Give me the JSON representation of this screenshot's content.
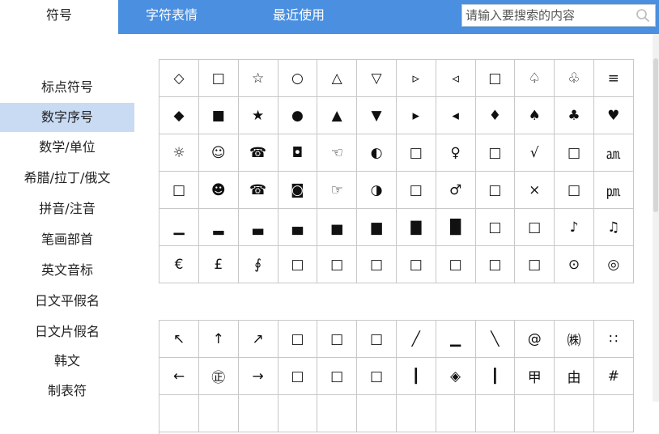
{
  "tabs": [
    {
      "label": "符号"
    },
    {
      "label": "字符表情"
    },
    {
      "label": "最近使用"
    }
  ],
  "search": {
    "placeholder": "请输入要搜索的内容"
  },
  "sidebar": {
    "items": [
      {
        "label": "标点符号"
      },
      {
        "label": "数字序号"
      },
      {
        "label": "数学/单位"
      },
      {
        "label": "希腊/拉丁/俄文"
      },
      {
        "label": "拼音/注音"
      },
      {
        "label": "笔画部首"
      },
      {
        "label": "英文音标"
      },
      {
        "label": "日文平假名"
      },
      {
        "label": "日文片假名"
      },
      {
        "label": "韩文"
      },
      {
        "label": "制表符"
      }
    ],
    "active_index": 1
  },
  "grids": [
    {
      "rows": [
        [
          "◇",
          "□",
          "☆",
          "○",
          "△",
          "▽",
          "▹",
          "◃",
          "□",
          "♤",
          "♧",
          "≡"
        ],
        [
          "◆",
          "■",
          "★",
          "●",
          "▲",
          "▼",
          "▸",
          "◂",
          "♦",
          "♠",
          "♣",
          "♥"
        ],
        [
          "☼",
          "☺",
          "☎",
          "◘",
          "☜",
          "◐",
          "□",
          "♀",
          "□",
          "√",
          "□",
          "㏂"
        ],
        [
          "□",
          "☻",
          "☎",
          "◙",
          "☞",
          "◑",
          "□",
          "♂",
          "□",
          "×",
          "□",
          "㏘"
        ],
        [
          "▁",
          "▂",
          "▃",
          "▄",
          "▅",
          "▆",
          "▇",
          "█",
          "□",
          "□",
          "♪",
          "♫"
        ],
        [
          "€",
          "£",
          "∮",
          "□",
          "□",
          "□",
          "□",
          "□",
          "□",
          "□",
          "⊙",
          "◎"
        ]
      ]
    },
    {
      "rows": [
        [
          "↖",
          "↑",
          "↗",
          "□",
          "□",
          "□",
          "╱",
          "▁",
          "╲",
          "@",
          "㈱",
          "∷"
        ],
        [
          "←",
          "㊣",
          "→",
          "□",
          "□",
          "□",
          "┃",
          "◈",
          "┃",
          "甲",
          "由",
          "#"
        ],
        [
          "",
          "",
          "",
          "",
          "",
          "",
          "",
          "",
          "",
          "",
          "",
          ""
        ]
      ]
    }
  ],
  "colors": {
    "accent": "#4a8fe0",
    "active_sidebar": "#c9daf3",
    "grid_line": "#c8c8c8"
  }
}
